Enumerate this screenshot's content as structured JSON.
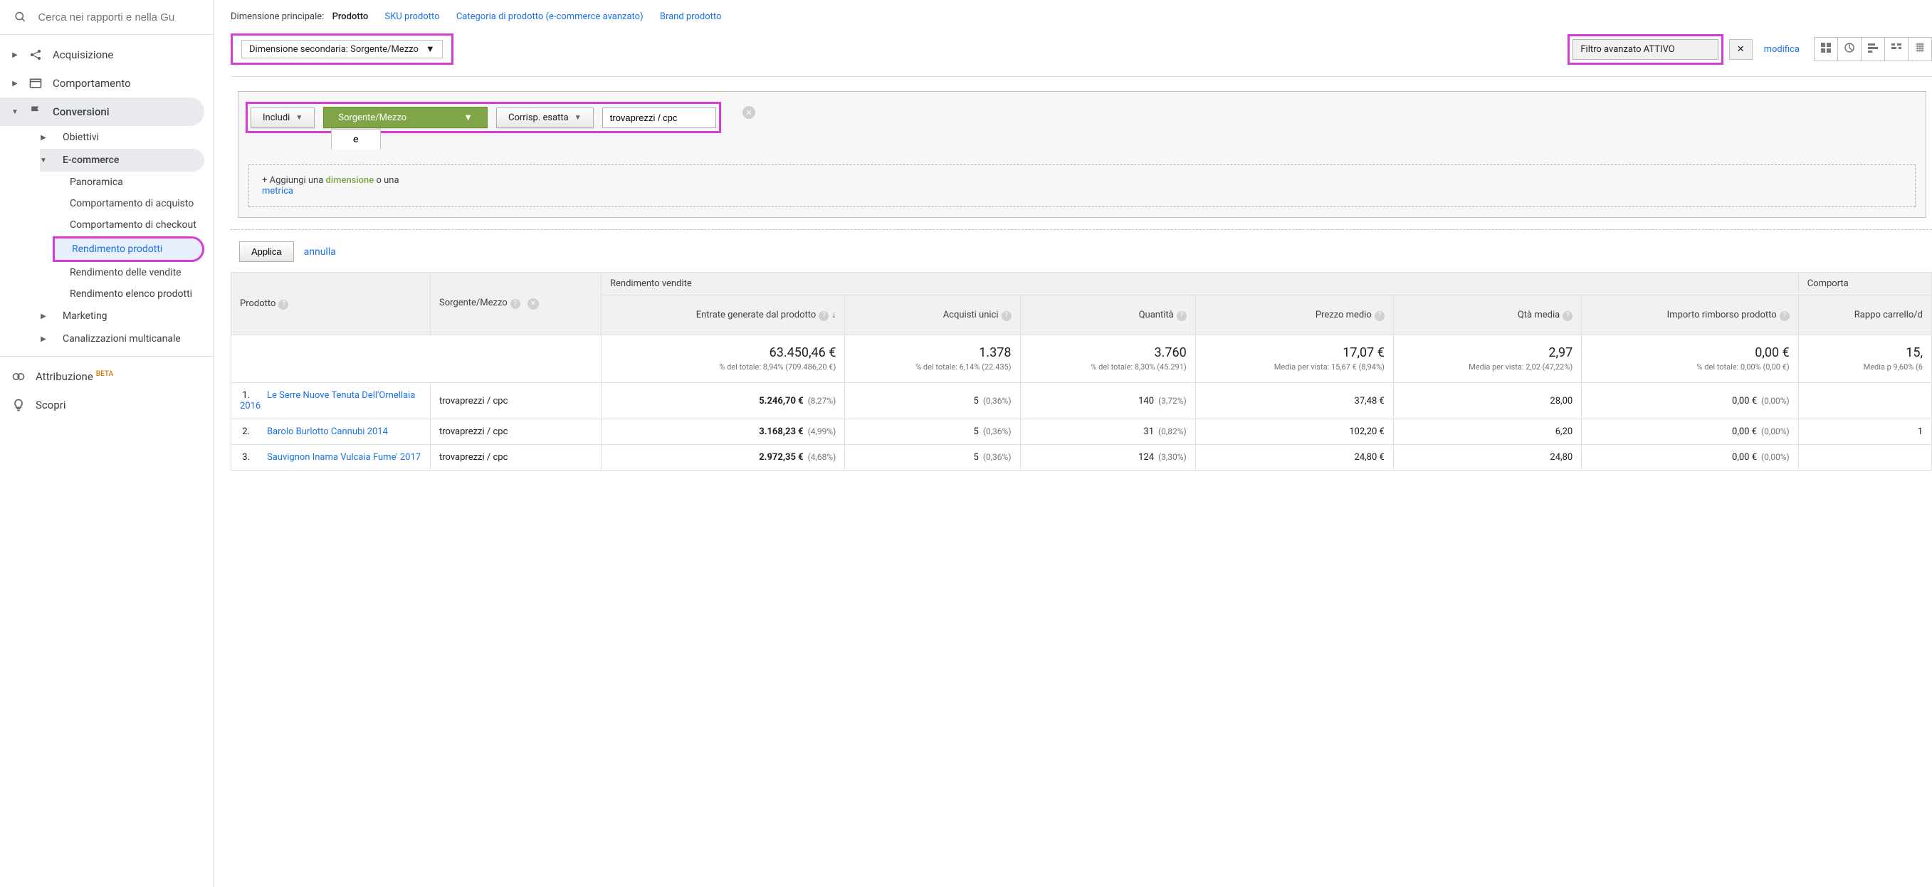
{
  "search": {
    "placeholder": "Cerca nei rapporti e nella Gu"
  },
  "sidebar": {
    "acquisition": "Acquisizione",
    "behavior": "Comportamento",
    "conversions": "Conversioni",
    "objectives": "Obiettivi",
    "ecommerce": "E-commerce",
    "ecommerce_items": {
      "overview": "Panoramica",
      "shopping_behavior": "Comportamento di acquisto",
      "checkout_behavior": "Comportamento di checkout",
      "product_performance": "Rendimento prodotti",
      "sales_performance": "Rendimento delle vendite",
      "product_list_performance": "Rendimento elenco prodotti"
    },
    "marketing": "Marketing",
    "multichannel": "Canalizzazioni multicanale",
    "attribution": "Attribuzione",
    "attribution_badge": "BETA",
    "discover": "Scopri"
  },
  "dimensions": {
    "label": "Dimensione principale:",
    "product": "Prodotto",
    "sku": "SKU prodotto",
    "category": "Categoria di prodotto (e-commerce avanzato)",
    "brand": "Brand prodotto"
  },
  "toolbar": {
    "secondary_dim": "Dimensione secondaria: Sorgente/Mezzo",
    "adv_filter": "Filtro avanzato ATTIVO",
    "edit": "modifica"
  },
  "filter": {
    "include": "Includi",
    "dimension": "Sorgente/Mezzo",
    "match": "Corrisp. esatta",
    "value": "trovaprezzi / cpc",
    "e": "e",
    "add_prefix": "+ Aggiungi una ",
    "add_dim": "dimensione",
    "add_or": " o una ",
    "add_metric": "metrica"
  },
  "apply": {
    "btn": "Applica",
    "cancel": "annulla"
  },
  "table": {
    "group_sales": "Rendimento vendite",
    "group_shopping": "Comporta",
    "col_product": "Prodotto",
    "col_source": "Sorgente/Mezzo",
    "col_revenue": "Entrate generate dal prodotto",
    "col_purchases": "Acquisti unici",
    "col_quantity": "Quantità",
    "col_avg_price": "Prezzo medio",
    "col_avg_qty": "Qtà media",
    "col_refund": "Importo rimborso prodotto",
    "col_ratio": "Rappo carrello/d",
    "summary": {
      "revenue": "63.450,46 €",
      "revenue_sub": "% del totale: 8,94% (709.486,20 €)",
      "purchases": "1.378",
      "purchases_sub": "% del totale: 6,14% (22.435)",
      "quantity": "3.760",
      "quantity_sub": "% del totale: 8,30% (45.291)",
      "avg_price": "17,07 €",
      "avg_price_sub": "Media per vista: 15,67 € (8,94%)",
      "avg_qty": "2,97",
      "avg_qty_sub": "Media per vista: 2,02 (47,22%)",
      "refund": "0,00 €",
      "refund_sub": "% del totale: 0,00% (0,00 €)",
      "ratio": "15,",
      "ratio_sub": "Media p 9,60% (6"
    },
    "rows": [
      {
        "idx": "1.",
        "product": "Le Serre Nuove Tenuta Dell'Ornellaia 2016",
        "source": "trovaprezzi / cpc",
        "revenue": "5.246,70 €",
        "revenue_pct": "(8,27%)",
        "purchases": "5",
        "purchases_pct": "(0,36%)",
        "qty": "140",
        "qty_pct": "(3,72%)",
        "price": "37,48 €",
        "avg_qty": "28,00",
        "refund": "0,00 €",
        "refund_pct": "(0,00%)"
      },
      {
        "idx": "2.",
        "product": "Barolo Burlotto Cannubi 2014",
        "source": "trovaprezzi / cpc",
        "revenue": "3.168,23 €",
        "revenue_pct": "(4,99%)",
        "purchases": "5",
        "purchases_pct": "(0,36%)",
        "qty": "31",
        "qty_pct": "(0,82%)",
        "price": "102,20 €",
        "avg_qty": "6,20",
        "refund": "0,00 €",
        "refund_pct": "(0,00%)",
        "ratio": "1"
      },
      {
        "idx": "3.",
        "product": "Sauvignon Inama Vulcaia Fume' 2017",
        "source": "trovaprezzi / cpc",
        "revenue": "2.972,35 €",
        "revenue_pct": "(4,68%)",
        "purchases": "5",
        "purchases_pct": "(0,36%)",
        "qty": "124",
        "qty_pct": "(3,30%)",
        "price": "24,80 €",
        "avg_qty": "24,80",
        "refund": "0,00 €",
        "refund_pct": "(0,00%)"
      }
    ]
  }
}
